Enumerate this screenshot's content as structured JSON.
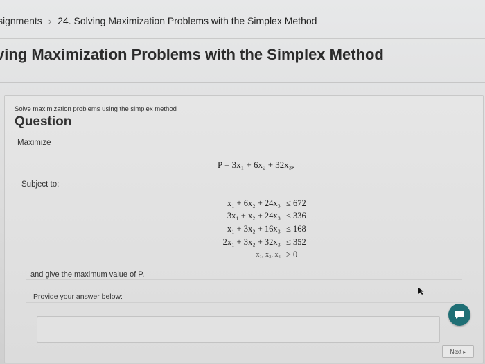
{
  "breadcrumb": {
    "parent": "ssignments",
    "separator": "›",
    "current": "24. Solving Maximization Problems with the Simplex Method"
  },
  "page_title": "ving Maximization Problems with the Simplex Method",
  "question": {
    "subtitle": "Solve maximization problems using the simplex method",
    "heading": "Question",
    "maximize_label": "Maximize",
    "objective": "P = 3x₁ + 6x₂ + 32x₃,",
    "subject_label": "Subject to:",
    "constraints": [
      {
        "lhs": "x₁ + 6x₂ + 24x₃",
        "rhs": "≤ 672"
      },
      {
        "lhs": "3x₁ + x₂ + 24x₃",
        "rhs": "≤ 336"
      },
      {
        "lhs": "x₁ + 3x₂ + 16x₃",
        "rhs": "≤ 168"
      },
      {
        "lhs": "2x₁ + 3x₂ + 32x₃",
        "rhs": "≤ 352"
      },
      {
        "lhs": "x₁, x₂, x₃",
        "rhs": "≥ 0"
      }
    ],
    "answer_prompt": "and give the maximum value of P.",
    "provide_label": "Provide your answer below:"
  },
  "next_label": "Next ▸",
  "icons": {
    "cursor": "cursor-icon",
    "help": "chat-help-icon"
  },
  "colors": {
    "accent": "#1f6f75"
  }
}
